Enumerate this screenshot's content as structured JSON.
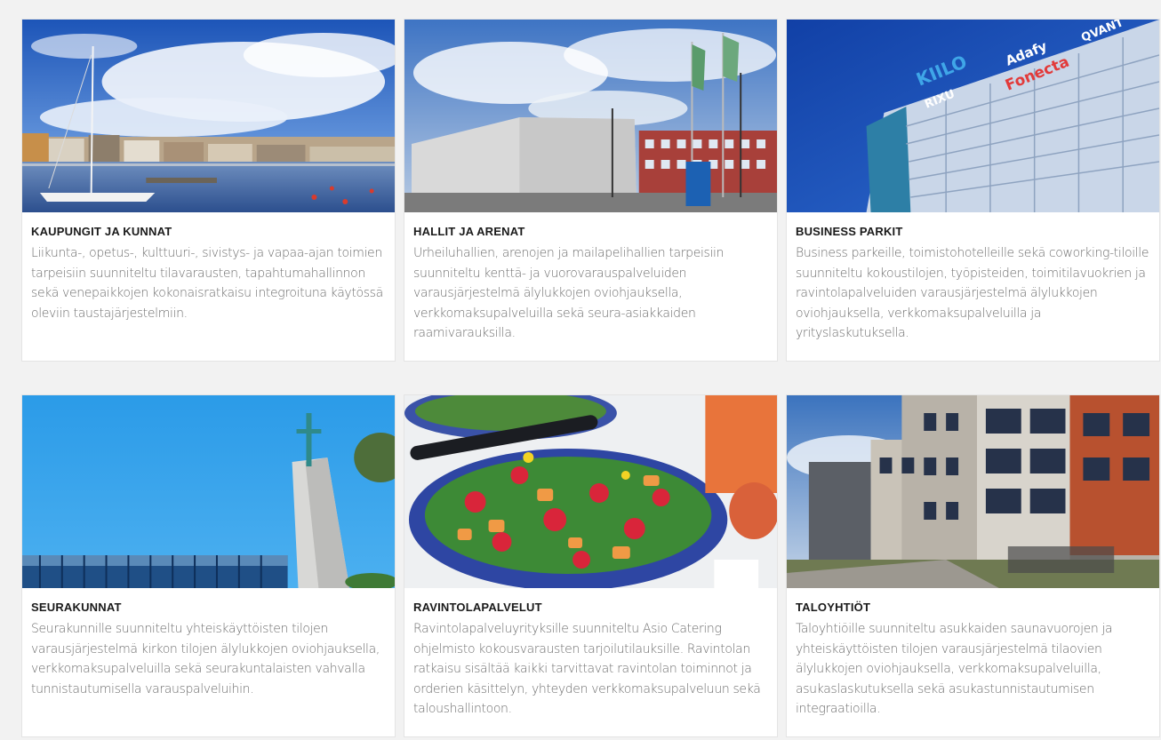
{
  "cards": [
    {
      "title": "KAUPUNGIT JA KUNNAT",
      "text": "Liikunta-, opetus-, kulttuuri-, sivistys- ja vapaa-ajan toimien tarpeisiin suunniteltu tilavaraustenm, tapahtumahallinnon sekä venepaikkojen kokonaisratkaisu integroituna käytössä oleviin taustajärjestelmiin.",
      "image": "harbor-city-photo"
    },
    {
      "title": "HALLIT JA ARENAT",
      "text": "Urheiluhallien, arenojen ja mailapelihallien tarpeisiin suunniteltu kenttä- ja vuorovarauspalveluiden varausjärjestelmä älylukkojen oviohjauksella, verkkomaksupalveluilla sekä seura-asiakkaiden raamivarauksilla.",
      "image": "arena-building-photo"
    },
    {
      "title": "BUSINESS PARKIT",
      "text": "Business parkeille, toimistohotelleille sekä coworking-tiloille suunniteltu kokoustilojen, työpisteiden, toimitilavuokrien ja ravintolapalveluiden varausjärjestelmä älylukkojen oviohjauksella, verkkomaksupalveluilla ja yrityslaskutuksella.",
      "image": "office-tower-photo",
      "signs": [
        "KIILO",
        "RIXU",
        "Adafy",
        "Fonecta",
        "QVANT"
      ]
    },
    {
      "title": "SEURAKUNNAT",
      "text": "Seurakunnille suunniteltu yhteiskäyttöisten tilojen varausjärjestelmä kirkon tilojen älylukkojen oviohjauksella, verkkomaksupalveluilla sekä seurakuntalaisten vahvalla tunnistautumisella varauspalveluihin.",
      "image": "church-tower-photo"
    },
    {
      "title": "RAVINTOLAPALVELUT",
      "text": "Ravintolapalveluyrityksille suunniteltu Asio Catering ohjelmisto kokousvarausten tarjoilutilauksille. Ravintolan ratkaisu sisältää kaikki tarvittavat ravintolan toiminnot ja orderien käsittelyn, yhteyden verkkomaksupalveluun sekä taloushallintoon.",
      "image": "salad-bowl-photo"
    },
    {
      "title": "TALOYHTIÖT",
      "text": "Taloyhtiöille suunniteltu asukkaiden saunavuorojen ja yhteiskäyttöisten tilojen varausjärjestelmä tilaovien älylukkojen oviohjauksella, verkkomaksupalveluilla, asukaslaskutuksella sekä asukastunnistautumisen integraatioilla.",
      "image": "apartment-building-photo"
    }
  ]
}
